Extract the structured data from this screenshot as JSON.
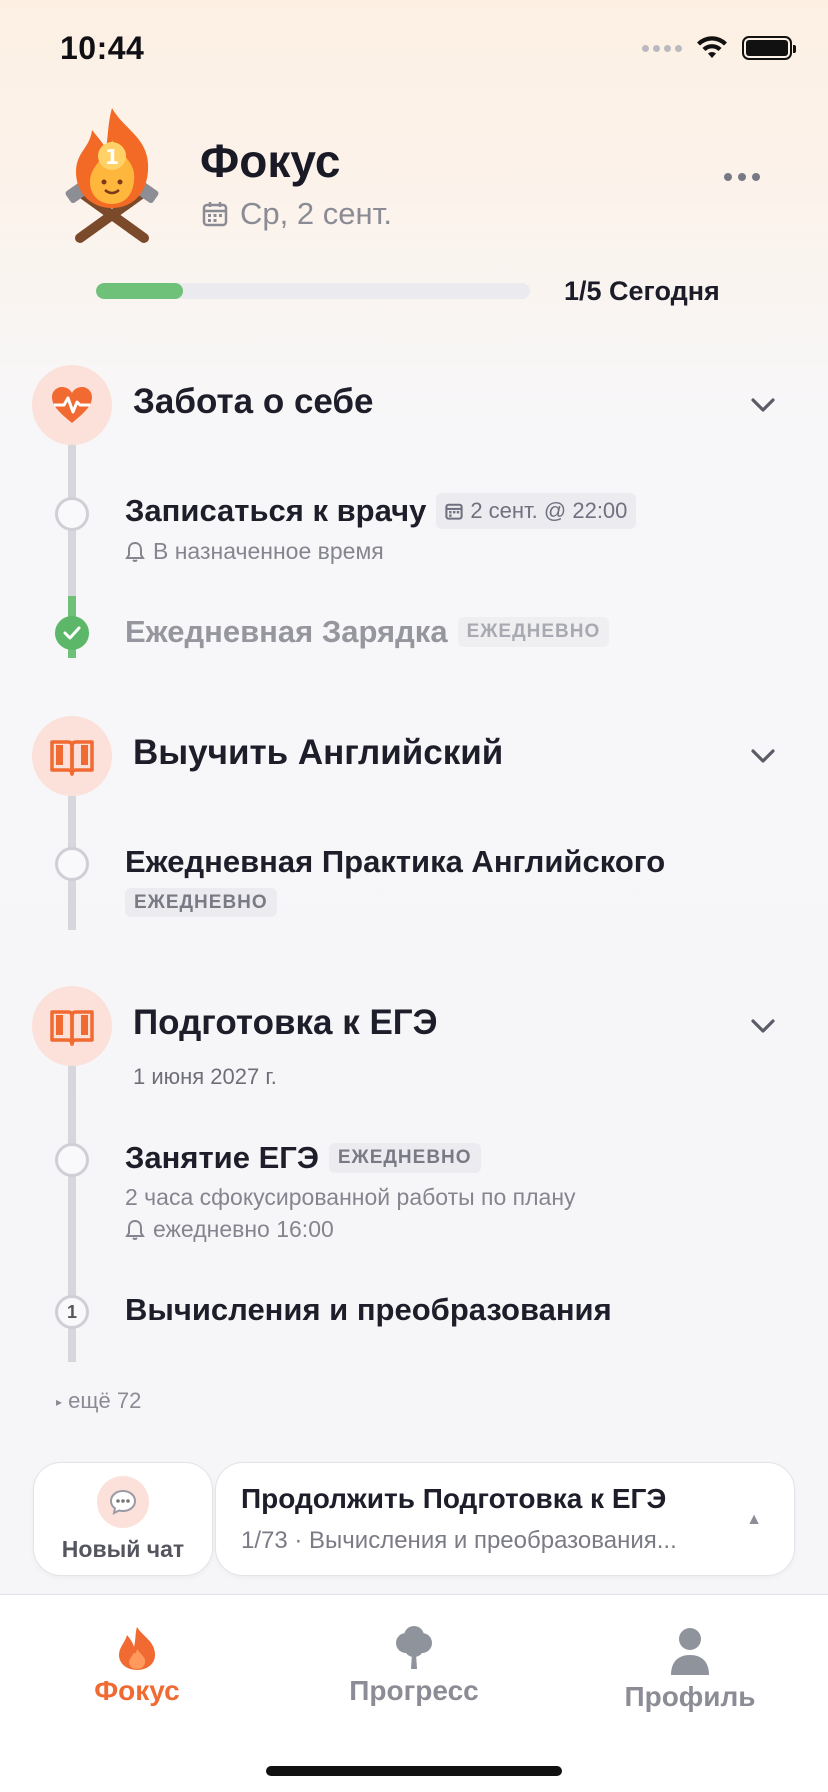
{
  "status": {
    "time": "10:44"
  },
  "header": {
    "title": "Фокус",
    "date": "Ср, 2 сент.",
    "progress": {
      "value": 0.2,
      "label": "1/5 Сегодня"
    }
  },
  "groups": [
    {
      "title": "Забота о себе",
      "icon": "heart-pulse-icon",
      "tasks": [
        {
          "title": "Записаться к врачу",
          "chip": "2 сент. @ 22:00",
          "reminder": "В назначенное время",
          "done": false
        },
        {
          "title": "Ежедневная Зарядка",
          "chip": "ЕЖЕДНЕВНО",
          "done": true
        }
      ]
    },
    {
      "title": "Выучить Английский",
      "icon": "book-icon",
      "tasks": [
        {
          "title": "Ежедневная Практика Английского",
          "chip": "ЕЖЕДНЕВНО",
          "done": false
        }
      ]
    },
    {
      "title": "Подготовка к ЕГЭ",
      "subtitle": "1 июня 2027 г.",
      "icon": "book-icon",
      "tasks": [
        {
          "title": "Занятие ЕГЭ",
          "chip": "ЕЖЕДНЕВНО",
          "description": "2 часа сфокусированной работы по плану",
          "reminder": "ежедневно 16:00",
          "done": false
        },
        {
          "title": "Вычисления и преобразования",
          "number": "1",
          "done": false
        }
      ],
      "more": "ещё 72"
    }
  ],
  "actions": {
    "new_chat": "Новый чат",
    "continue_title": "Продолжить Подготовка к ЕГЭ",
    "continue_subtitle": "1/73 · Вычисления и преобразования..."
  },
  "tabs": [
    {
      "label": "Фокус",
      "icon": "flame-icon",
      "active": true
    },
    {
      "label": "Прогресс",
      "icon": "tree-icon",
      "active": false
    },
    {
      "label": "Профиль",
      "icon": "person-icon",
      "active": false
    }
  ],
  "colors": {
    "accent": "#f06a32",
    "success": "#6fc079",
    "icon_bg": "#fbe1d9"
  }
}
